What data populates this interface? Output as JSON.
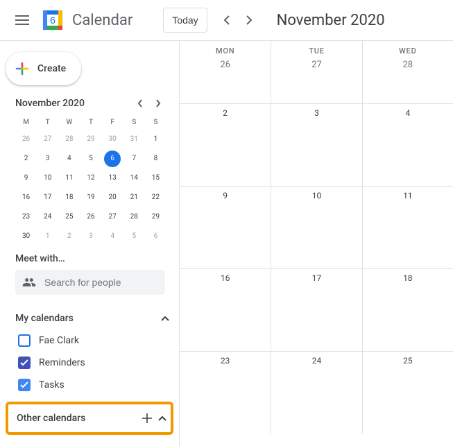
{
  "header": {
    "app_title": "Calendar",
    "logo_day": "6",
    "today_label": "Today",
    "date_label": "November 2020"
  },
  "create": {
    "label": "Create"
  },
  "mini": {
    "title": "November 2020",
    "dow": [
      "M",
      "T",
      "W",
      "T",
      "F",
      "S",
      "S"
    ],
    "weeks": [
      [
        {
          "n": "26",
          "out": true
        },
        {
          "n": "27",
          "out": true
        },
        {
          "n": "28",
          "out": true
        },
        {
          "n": "29",
          "out": true
        },
        {
          "n": "30",
          "out": true
        },
        {
          "n": "31",
          "out": true
        },
        {
          "n": "1"
        }
      ],
      [
        {
          "n": "2"
        },
        {
          "n": "3"
        },
        {
          "n": "4"
        },
        {
          "n": "5"
        },
        {
          "n": "6",
          "sel": true
        },
        {
          "n": "7"
        },
        {
          "n": "8"
        }
      ],
      [
        {
          "n": "9"
        },
        {
          "n": "10"
        },
        {
          "n": "11"
        },
        {
          "n": "12"
        },
        {
          "n": "13"
        },
        {
          "n": "14"
        },
        {
          "n": "15"
        }
      ],
      [
        {
          "n": "16"
        },
        {
          "n": "17"
        },
        {
          "n": "18"
        },
        {
          "n": "19"
        },
        {
          "n": "20"
        },
        {
          "n": "21"
        },
        {
          "n": "22"
        }
      ],
      [
        {
          "n": "23"
        },
        {
          "n": "24"
        },
        {
          "n": "25"
        },
        {
          "n": "26"
        },
        {
          "n": "27"
        },
        {
          "n": "28"
        },
        {
          "n": "29"
        }
      ],
      [
        {
          "n": "30"
        },
        {
          "n": "1",
          "out": true
        },
        {
          "n": "2",
          "out": true
        },
        {
          "n": "3",
          "out": true
        },
        {
          "n": "4",
          "out": true
        },
        {
          "n": "5",
          "out": true
        },
        {
          "n": "6",
          "out": true
        }
      ]
    ]
  },
  "meet": {
    "title": "Meet with…",
    "placeholder": "Search for people"
  },
  "my_calendars": {
    "title": "My calendars",
    "items": [
      {
        "label": "Fae Clark",
        "checked": false,
        "color": "#1a73e8"
      },
      {
        "label": "Reminders",
        "checked": true,
        "color": "#3f51b5"
      },
      {
        "label": "Tasks",
        "checked": true,
        "color": "#4285f4"
      }
    ]
  },
  "other_calendars": {
    "title": "Other calendars"
  },
  "grid": {
    "dow": [
      "MON",
      "TUE",
      "WED"
    ],
    "header_days": [
      "26",
      "27",
      "28"
    ],
    "weeks": [
      [
        "2",
        "3",
        "4"
      ],
      [
        "9",
        "10",
        "11"
      ],
      [
        "16",
        "17",
        "18"
      ],
      [
        "23",
        "24",
        "25"
      ]
    ]
  },
  "colors": {
    "google_blue": "#1a73e8",
    "highlight": "#f29900"
  }
}
